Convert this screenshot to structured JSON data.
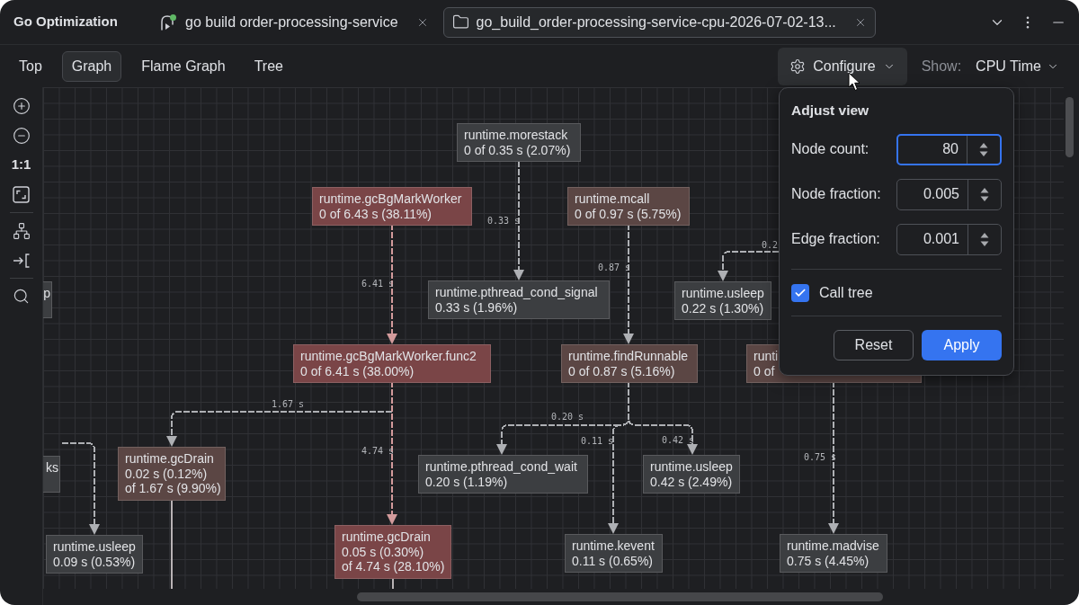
{
  "window": {
    "title": "Go Optimization"
  },
  "tabs": [
    {
      "label": "go build order-processing-service",
      "kind": "run",
      "selected": false
    },
    {
      "label": "go_build_order-processing-service-cpu-2026-07-02-13...",
      "kind": "folder",
      "selected": true
    }
  ],
  "view_tabs": [
    {
      "label": "Top",
      "selected": false
    },
    {
      "label": "Graph",
      "selected": true
    },
    {
      "label": "Flame Graph",
      "selected": false
    },
    {
      "label": "Tree",
      "selected": false
    }
  ],
  "configure": {
    "label": "Configure",
    "expanded": true
  },
  "show": {
    "label": "Show:",
    "value": "CPU Time"
  },
  "toolbar": {
    "actual_size": "1:1"
  },
  "graph": {
    "nodes": [
      {
        "lines": [
          "runtime.morestack",
          "0 of 0.35 s (2.07%)"
        ],
        "color": "#3c3e41"
      },
      {
        "lines": [
          "runtime.gcBgMarkWorker",
          "0 of 6.43 s (38.11%)"
        ],
        "color": "#7a4547"
      },
      {
        "lines": [
          "runtime.mcall",
          "0 of 0.97 s (5.75%)"
        ],
        "color": "#5b4644"
      },
      {
        "lines": [
          "p"
        ],
        "color": "#3c3e41"
      },
      {
        "lines": [
          "runtime.pthread_cond_signal",
          "0.33 s (1.96%)"
        ],
        "color": "#3c3e41"
      },
      {
        "lines": [
          "runtime.usleep",
          "0.22 s (1.30%)"
        ],
        "color": "#3c3e41"
      },
      {
        "lines": [
          "runtime.gcBgMarkWorker.func2",
          "0 of 6.41 s (38.00%)"
        ],
        "color": "#7a4547"
      },
      {
        "lines": [
          "runtime.findRunnable",
          "0 of 0.87 s (5.16%)"
        ],
        "color": "#5b4644"
      },
      {
        "lines": [
          "runti",
          "0 of"
        ],
        "color": "#5b4644"
      },
      {
        "lines": [
          "ks"
        ],
        "color": "#3c3e41"
      },
      {
        "lines": [
          "runtime.gcDrain",
          "0.02 s (0.12%)",
          "of 1.67 s (9.90%)"
        ],
        "color": "#5b4644"
      },
      {
        "lines": [
          "runtime.pthread_cond_wait",
          "0.20 s (1.19%)"
        ],
        "color": "#3c3e41"
      },
      {
        "lines": [
          "runtime.usleep",
          "0.42 s (2.49%)"
        ],
        "color": "#3c3e41"
      },
      {
        "lines": [
          "runtime.usleep",
          "0.09 s (0.53%)"
        ],
        "color": "#3c3e41"
      },
      {
        "lines": [
          "runtime.gcDrain",
          "0.05 s (0.30%)",
          "of 4.74 s (28.10%)"
        ],
        "color": "#7a4547"
      },
      {
        "lines": [
          "runtime.kevent",
          "0.11 s (0.65%)"
        ],
        "color": "#3c3e41"
      },
      {
        "lines": [
          "runtime.madvise",
          "0.75 s (4.45%)"
        ],
        "color": "#3c3e41"
      }
    ],
    "edges": [
      {
        "label": "0.33 s",
        "color": "#aeb0b4",
        "kind": "dashed"
      },
      {
        "label": "6.41 s",
        "color": "#d39b9c",
        "kind": "dashed"
      },
      {
        "label": "0.87 s",
        "color": "#aeb0b4",
        "kind": "dashed"
      },
      {
        "label": "0.2",
        "color": "#aeb0b4",
        "kind": "dashed"
      },
      {
        "label": "1.67 s",
        "color": "#aeb0b4",
        "kind": "dashed"
      },
      {
        "label": "4.74 s",
        "color": "#d39b9c",
        "kind": "dashed"
      },
      {
        "label": "0.20 s",
        "color": "#aeb0b4",
        "kind": "dashed"
      },
      {
        "label": "0.11 s",
        "color": "#aeb0b4",
        "kind": "dashed"
      },
      {
        "label": "0.42 s",
        "color": "#aeb0b4",
        "kind": "dashed"
      },
      {
        "label": "0.75 s",
        "color": "#aeb0b4",
        "kind": "dashed"
      },
      {
        "color": "#aeb0b4",
        "kind": "dashed"
      },
      {
        "kind": "solid"
      },
      {
        "kind": "solid"
      }
    ]
  },
  "adjust_view": {
    "title": "Adjust view",
    "fields": [
      {
        "label": "Node count:",
        "value": "80",
        "focused": true
      },
      {
        "label": "Node fraction:",
        "value": "0.005",
        "focused": false
      },
      {
        "label": "Edge fraction:",
        "value": "0.001",
        "focused": false
      }
    ],
    "call_tree": {
      "label": "Call tree",
      "checked": true
    },
    "buttons": [
      {
        "label": "Reset",
        "kind": "secondary"
      },
      {
        "label": "Apply",
        "kind": "primary"
      }
    ]
  }
}
